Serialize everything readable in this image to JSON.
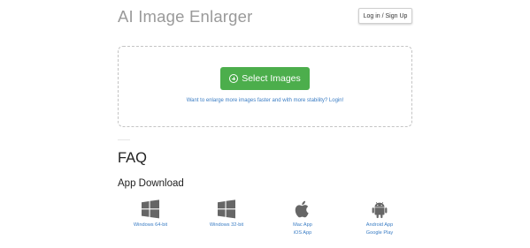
{
  "header": {
    "title": "AI Image Enlarger",
    "login_label": "Log in / Sign Up"
  },
  "upload": {
    "select_label": "Select Images",
    "login_hint": "Want to enlarge more images faster and with more stability? Login!"
  },
  "faq": {
    "title": "FAQ"
  },
  "app_download": {
    "title": "App Download",
    "items": [
      {
        "icon": "windows-icon",
        "links": [
          "Windows 64-bit"
        ]
      },
      {
        "icon": "windows-icon",
        "links": [
          "Windows 32-bit"
        ]
      },
      {
        "icon": "apple-icon",
        "links": [
          "Mac App",
          "iOS App"
        ]
      },
      {
        "icon": "android-icon",
        "links": [
          "Android App",
          "Google Play"
        ]
      }
    ]
  },
  "colors": {
    "accent_green": "#4cae4c",
    "link_blue": "#3b7dc4",
    "title_gray": "#9a9a9a",
    "icon_gray": "#666666"
  }
}
